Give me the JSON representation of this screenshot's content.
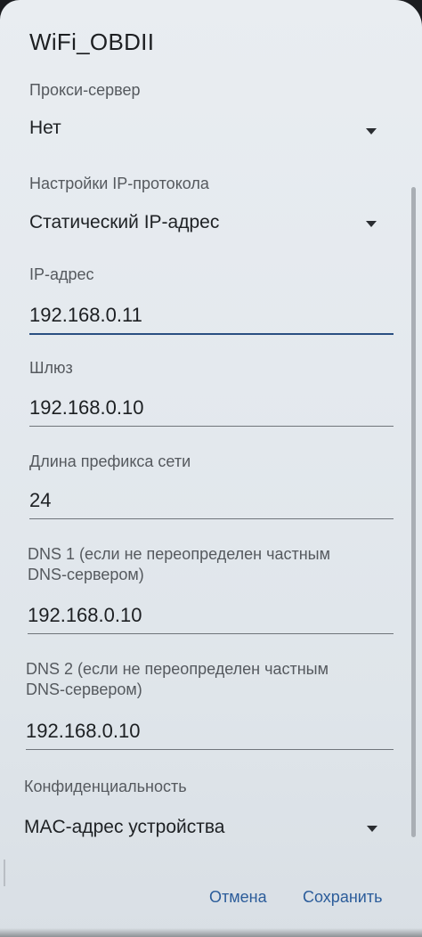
{
  "dialog": {
    "title": "WiFi_OBDII"
  },
  "proxy": {
    "label": "Прокси-сервер",
    "value": "Нет"
  },
  "ip_settings": {
    "label": "Настройки IP-протокола",
    "value": "Статический IP-адрес"
  },
  "ip_address": {
    "label": "IP-адрес",
    "value": "192.168.0.11"
  },
  "gateway": {
    "label": "Шлюз",
    "value": "192.168.0.10"
  },
  "prefix_length": {
    "label": "Длина префикса сети",
    "value": "24"
  },
  "dns1": {
    "label_line1": "DNS 1 (если не переопределен частным",
    "label_line2": "DNS-сервером)",
    "value": "192.168.0.10"
  },
  "dns2": {
    "label_line1": "DNS 2 (если не переопределен частным",
    "label_line2": "DNS-сервером)",
    "value": "192.168.0.10"
  },
  "privacy": {
    "label": "Конфиденциальность",
    "value": "MAC-адрес устройства"
  },
  "actions": {
    "cancel_label": "Отмена",
    "save_label": "Сохранить"
  },
  "colors": {
    "accent": "#2b5c9a",
    "background": "#e6eaee",
    "text_primary": "#1e2124",
    "text_secondary": "#55595e"
  }
}
